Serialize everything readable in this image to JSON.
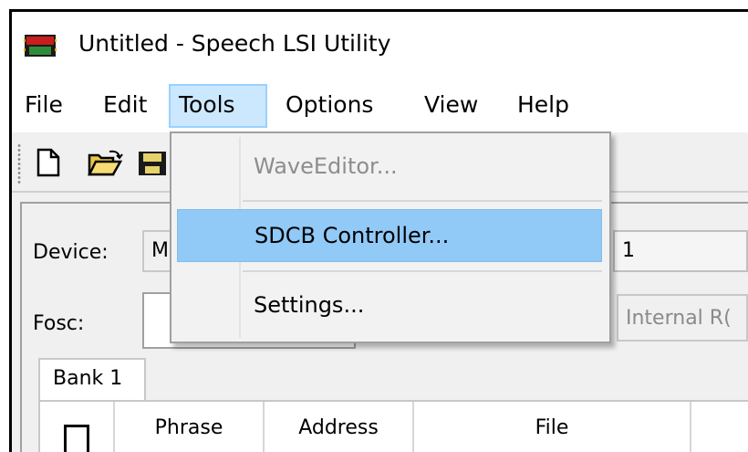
{
  "window": {
    "title": "Untitled - Speech LSI Utility",
    "icon": "lsi-chip-icon"
  },
  "menubar": {
    "items": [
      {
        "label": "File"
      },
      {
        "label": "Edit"
      },
      {
        "label": "Tools"
      },
      {
        "label": "Options"
      },
      {
        "label": "View"
      },
      {
        "label": "Help"
      }
    ],
    "active": "Tools"
  },
  "toolbar": {
    "icons": [
      "new-document-icon",
      "open-folder-icon",
      "save-icon"
    ]
  },
  "form": {
    "device_label": "Device:",
    "device_value": "M",
    "bank_value": "1",
    "fosc_label": "Fosc:",
    "fosc_value": "",
    "osc_source_value": "Internal R("
  },
  "tabs": [
    {
      "label": "Bank 1"
    }
  ],
  "table": {
    "columns": [
      {
        "label": ""
      },
      {
        "label": "Phrase"
      },
      {
        "label": "Address"
      },
      {
        "label": "File"
      }
    ]
  },
  "tools_menu": {
    "items": [
      {
        "label": "WaveEditor...",
        "enabled": false
      },
      {
        "label": "SDCB Controller...",
        "enabled": true,
        "highlighted": true
      },
      {
        "label": "Settings...",
        "enabled": true
      }
    ]
  },
  "colors": {
    "highlight": "#91c9f7",
    "menu_active": "#cce8ff",
    "chrome": "#f0f0f0"
  }
}
